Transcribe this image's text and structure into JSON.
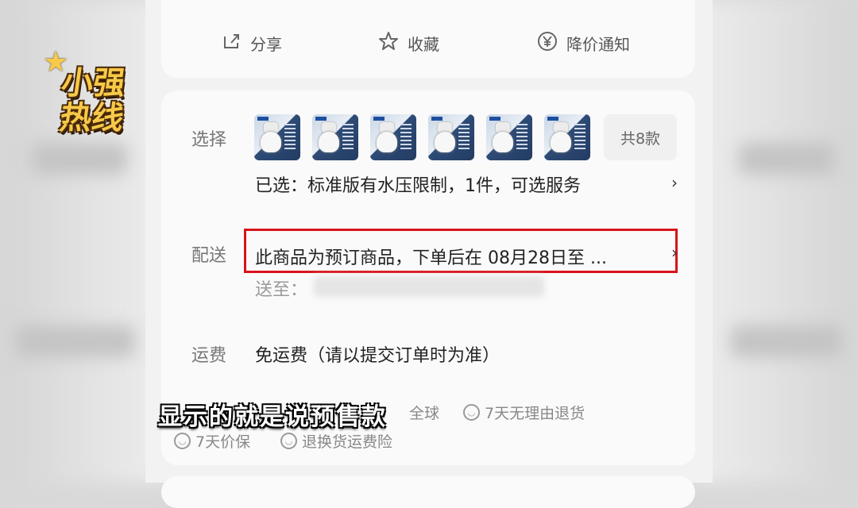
{
  "actions": {
    "share": "分享",
    "favorite": "收藏",
    "price_alert": "降价通知"
  },
  "select_row": {
    "label": "选择",
    "variant_count": "共8款",
    "selected": "已选：标准版有水压限制，1件，可选服务"
  },
  "delivery_row": {
    "label": "配送",
    "notice": "此商品为预订商品，下单后在 08月28日至 ...",
    "ship_to_label": "送至："
  },
  "shipping_fee_row": {
    "label": "运费",
    "value": "免运费（请以提交订单时为准）"
  },
  "services": {
    "global": "全球",
    "return": "7天无理由退货",
    "price_protect": "7天价保",
    "return_insurance": "退换货运费险"
  },
  "subtitle": "显示的就是说预售款",
  "logo": {
    "text_top": "小强",
    "text_bottom": "热线"
  },
  "colors": {
    "highlight": "#d8141c",
    "logo_gold": "#f7c948"
  }
}
